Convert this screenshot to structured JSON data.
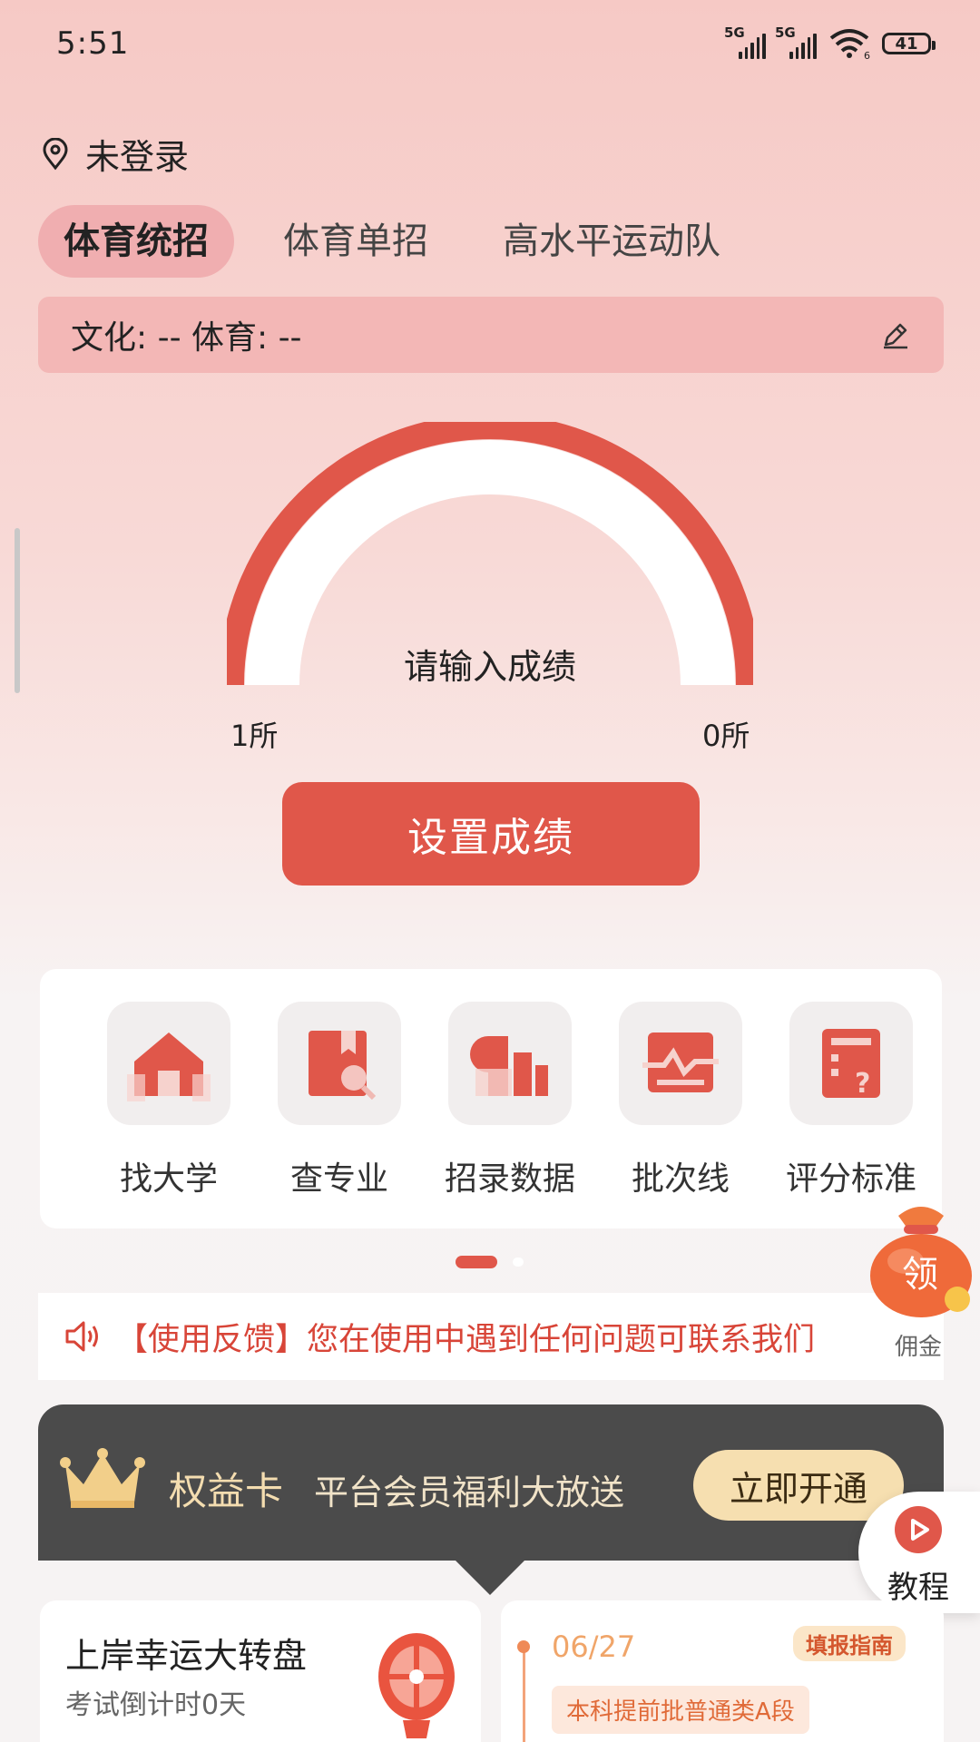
{
  "status_bar": {
    "time": "5:51",
    "battery": "41",
    "sim1": "5G",
    "sim2": "5G",
    "wifi_badge": "6"
  },
  "location": {
    "label": "未登录"
  },
  "tabs": [
    {
      "label": "体育统招",
      "active": true
    },
    {
      "label": "体育单招",
      "active": false
    },
    {
      "label": "高水平运动队",
      "active": false
    }
  ],
  "score": {
    "text": "文化: -- 体育: --"
  },
  "gauge": {
    "prompt": "请输入成绩",
    "min_label": "1所",
    "max_label": "0所"
  },
  "set_score_button": "设置成绩",
  "features": [
    {
      "label": "找大学",
      "icon": "house-icon"
    },
    {
      "label": "查专业",
      "icon": "book-search-icon"
    },
    {
      "label": "招录数据",
      "icon": "bar-chart-icon"
    },
    {
      "label": "批次线",
      "icon": "line-chart-icon"
    },
    {
      "label": "评分标准",
      "icon": "calculator-icon"
    }
  ],
  "notice": {
    "text": "【使用反馈】您在使用中遇到任何问题可联系我们"
  },
  "commission": {
    "bag_char": "领",
    "label": "佣金"
  },
  "vip": {
    "title": "权益卡",
    "subtitle": "平台会员福利大放送",
    "button": "立即开通"
  },
  "tutorial": {
    "label": "教程"
  },
  "card_left": {
    "title": "上岸幸运大转盘",
    "subtitle": "考试倒计时0天"
  },
  "card_right": {
    "date": "06/27",
    "tag": "填报指南",
    "batch": "本科提前批普通类A段"
  },
  "colors": {
    "accent": "#e0574a",
    "vip_bg": "#4b4b4b",
    "gold": "#f6dfb0"
  }
}
